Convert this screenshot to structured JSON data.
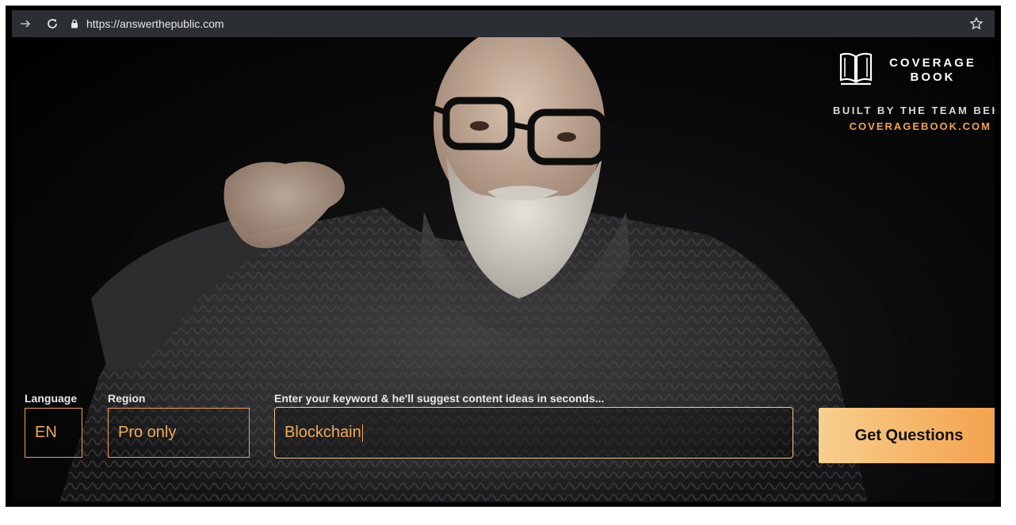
{
  "browser": {
    "url": "https://answerthepublic.com"
  },
  "brand": {
    "name": "COVERAGE\nBOOK",
    "tagline": "BUILT BY THE TEAM BEHI",
    "link": "COVERAGEBOOK.COM"
  },
  "form": {
    "language_label": "Language",
    "language_value": "EN",
    "region_label": "Region",
    "region_value": "Pro only",
    "keyword_label": "Enter your keyword & he'll suggest content ideas in seconds...",
    "keyword_value": "Blockchain",
    "submit_label": "Get Questions"
  },
  "colors": {
    "accent": "#f0a24b",
    "cta_start": "#f8cf8f",
    "cta_end": "#f3a24d",
    "chrome_bar": "#2b2e33"
  },
  "icons": [
    "forward-arrow-icon",
    "reload-icon",
    "lock-icon",
    "bookmark-star-icon",
    "coveragebook-logo-icon"
  ]
}
